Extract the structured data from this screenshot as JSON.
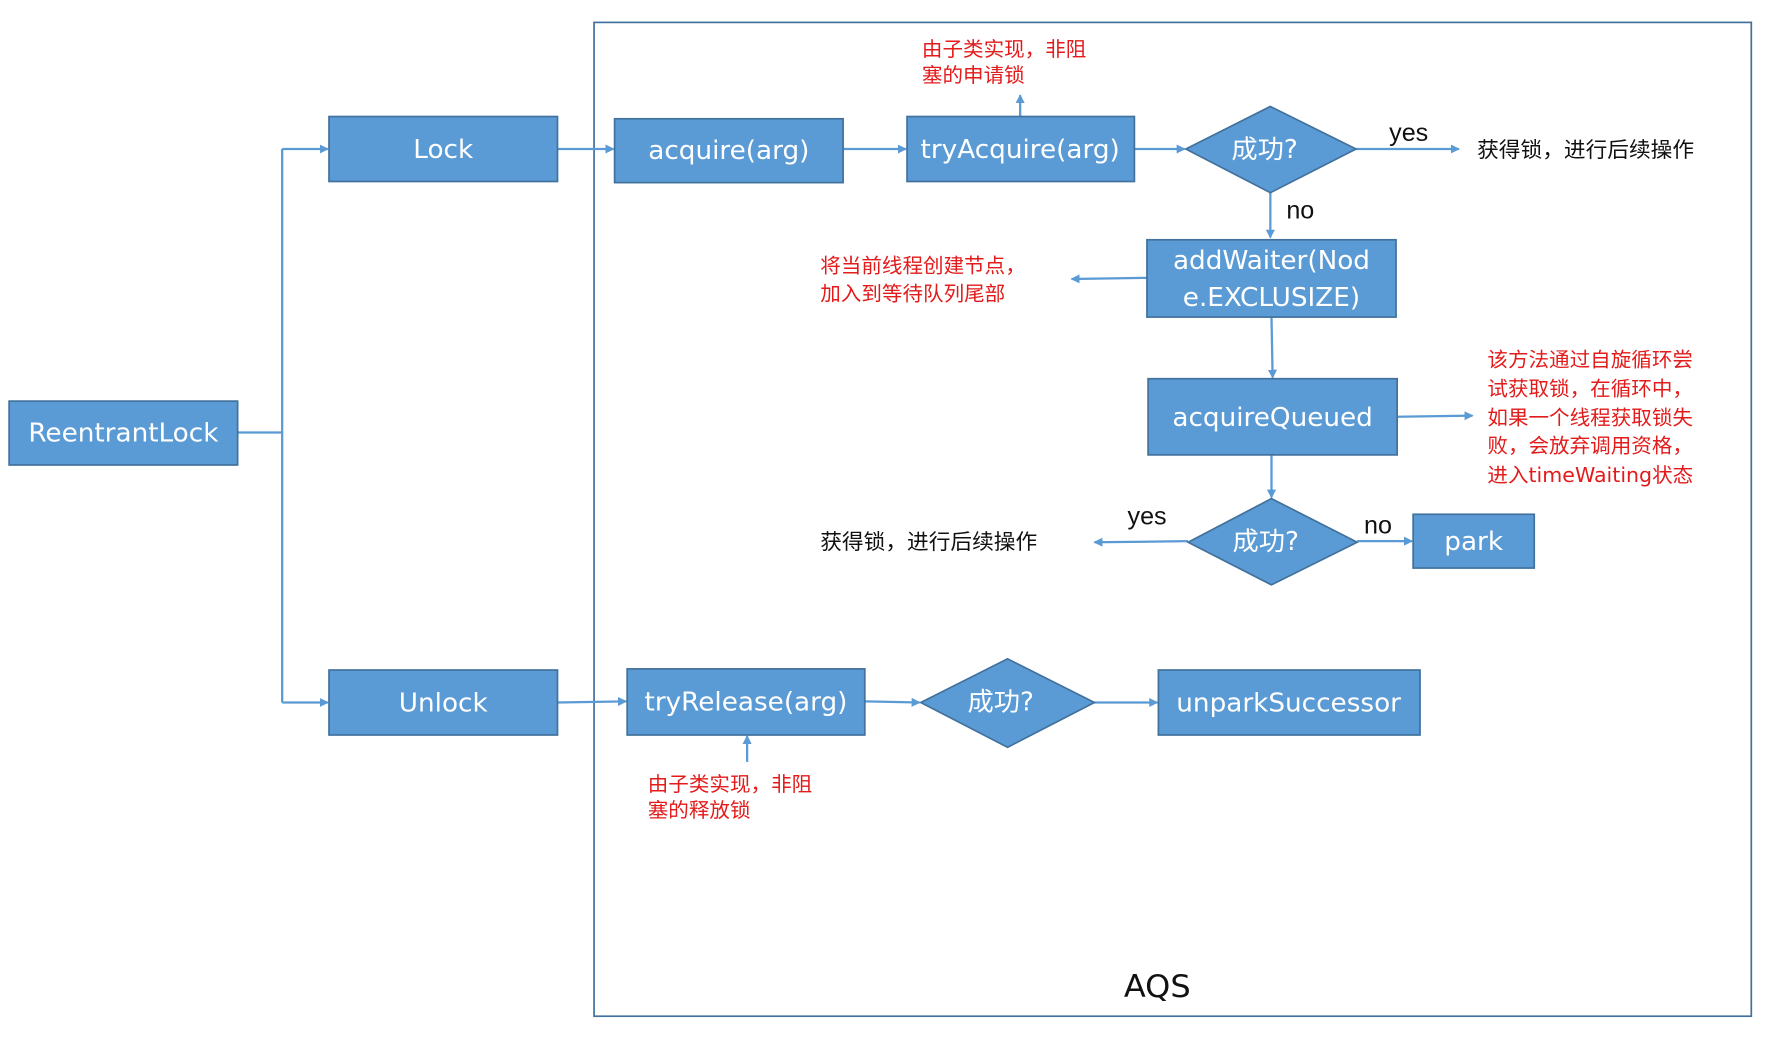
{
  "colors": {
    "node_fill": "#5b9bd5",
    "node_stroke": "#41719c",
    "arrow": "#5b9bd5",
    "note": "#e31b1b"
  },
  "container": {
    "label": "AQS"
  },
  "nodes": {
    "reentrant": "ReentrantLock",
    "lock": "Lock",
    "unlock": "Unlock",
    "acquire": "acquire(arg)",
    "try_acquire": "tryAcquire(arg)",
    "add_waiter": [
      "addWaiter(Nod",
      "e.EXCLUSIZE)"
    ],
    "acquire_queued": "acquireQueued",
    "park": "park",
    "try_release": "tryRelease(arg)",
    "unpark": "unparkSuccessor",
    "decision1": "成功?",
    "decision2": "成功?",
    "decision3": "成功?"
  },
  "edge_labels": {
    "yes1": "yes",
    "no1": "no",
    "yes2": "yes",
    "no2": "no"
  },
  "results": {
    "acquired1": "获得锁，进行后续操作",
    "acquired2": "获得锁，进行后续操作"
  },
  "notes": {
    "try_acquire": [
      "由子类实现，非阻",
      "塞的申请锁"
    ],
    "add_waiter": [
      "将当前线程创建节点，",
      "加入到等待队列尾部"
    ],
    "acquire_queued": [
      "该方法通过自旋循环尝",
      "试获取锁，在循环中，",
      "如果一个线程获取锁失",
      "败，会放弃调用资格，",
      "进入timeWaiting状态"
    ],
    "try_release": [
      "由子类实现，非阻",
      "塞的释放锁"
    ]
  }
}
